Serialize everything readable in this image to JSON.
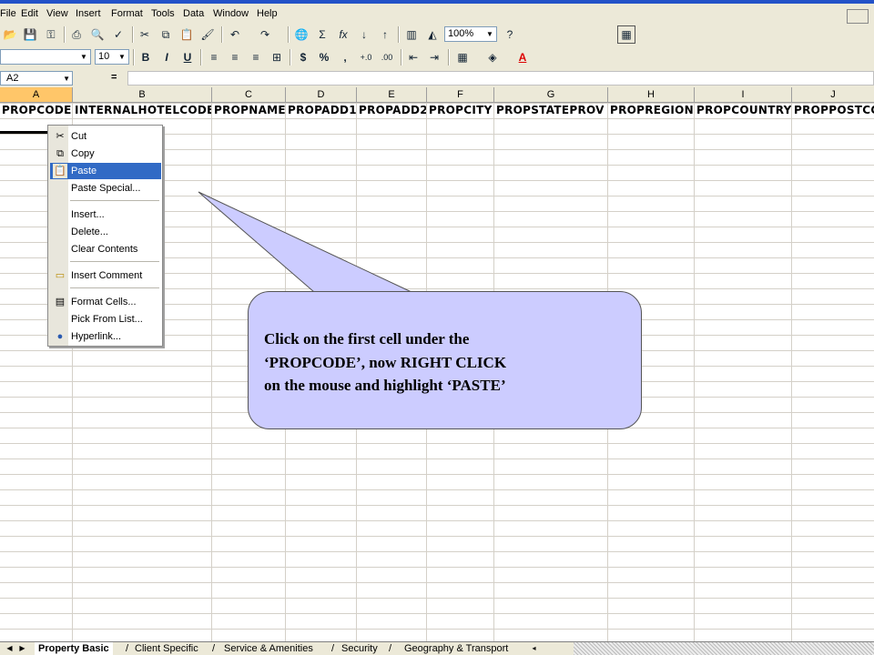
{
  "menubar": {
    "items": [
      "File",
      "Edit",
      "View",
      "Insert",
      "Format",
      "Tools",
      "Data",
      "Window",
      "Help"
    ]
  },
  "toolbar": {
    "zoom": "100%",
    "font_size": "10",
    "font_name": ""
  },
  "formula_bar": {
    "name_box": "A2",
    "equals": "="
  },
  "columns": {
    "letters": [
      "A",
      "B",
      "C",
      "D",
      "E",
      "F",
      "G",
      "H",
      "I",
      "J"
    ],
    "headers": [
      "PROPCODE",
      "INTERNALHOTELCODE",
      "PROPNAME",
      "PROPADD1",
      "PROPADD2",
      "PROPCITY",
      "PROPSTATEPROV",
      "PROPREGION",
      "PROPCOUNTRY",
      "PROPPOSTCODE"
    ]
  },
  "context_menu": {
    "items": [
      {
        "label": "Cut",
        "icon": "scissors-icon"
      },
      {
        "label": "Copy",
        "icon": "copy-icon"
      },
      {
        "label": "Paste",
        "icon": "paste-icon"
      },
      {
        "label": "Paste Special...",
        "icon": ""
      },
      {
        "label": "Insert...",
        "icon": ""
      },
      {
        "label": "Delete...",
        "icon": ""
      },
      {
        "label": "Clear Contents",
        "icon": ""
      },
      {
        "label": "Insert Comment",
        "icon": "comment-icon"
      },
      {
        "label": "Format Cells...",
        "icon": "format-cells-icon"
      },
      {
        "label": "Pick From List...",
        "icon": ""
      },
      {
        "label": "Hyperlink...",
        "icon": "globe-icon"
      }
    ],
    "highlighted": "Paste"
  },
  "callout": {
    "line1": "Click on the first cell under the",
    "line2": "‘PROPCODE’, now RIGHT CLICK",
    "line3": "on the mouse and highlight ‘PASTE’"
  },
  "sheet_tabs": [
    "Property Basic",
    "Client Specific",
    "Service & Amenities",
    "Security",
    "Geography & Transport"
  ],
  "colors": {
    "highlight": "#316ac5",
    "callout_fill": "#ccccff",
    "chrome": "#ece9d8"
  }
}
